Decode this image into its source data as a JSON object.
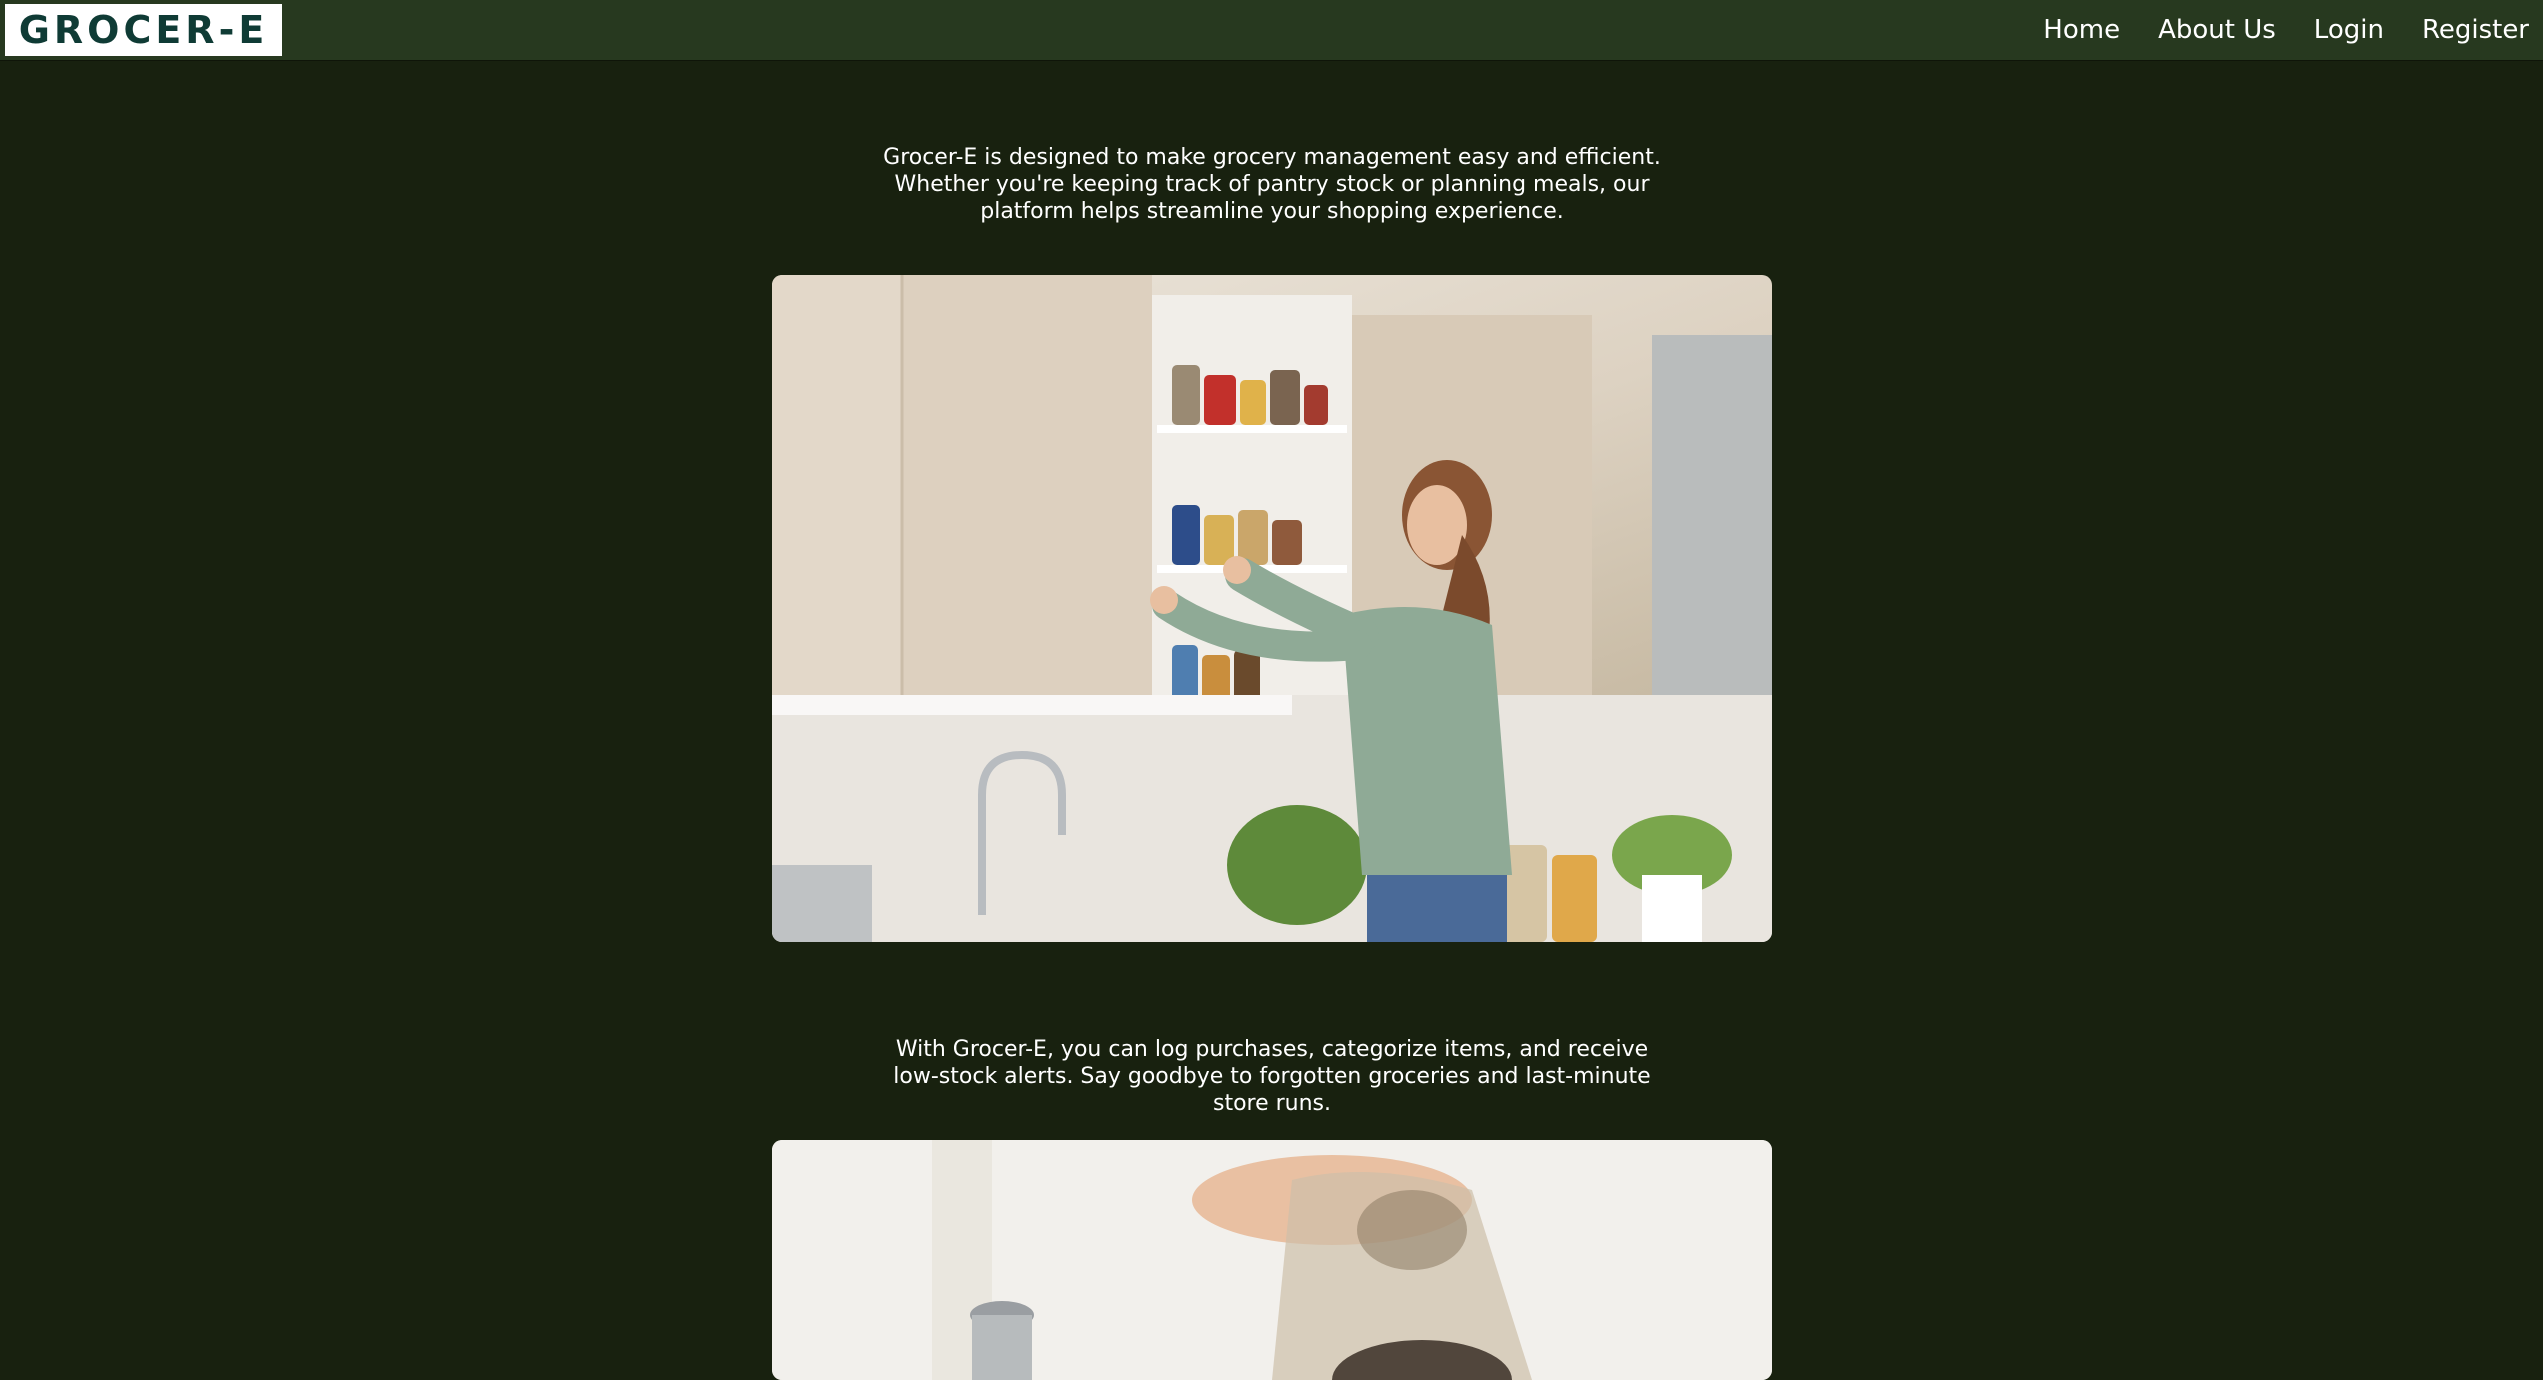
{
  "navbar": {
    "logo_text": "GROCER-E",
    "links": [
      "Home",
      "About Us",
      "Login",
      "Register"
    ]
  },
  "main": {
    "intro_text": "Grocer-E is designed to make grocery management easy and efficient. Whether you're keeping track of pantry stock or planning meals, our platform helps streamline your shopping experience.",
    "features_text": "With Grocer-E, you can log purchases, categorize items, and receive low-stock alerts. Say goodbye to forgotten groceries and last-minute store runs."
  },
  "colors": {
    "page_background": "#18210f",
    "navbar_background": "#27391f",
    "logo_text": "#0f3b35",
    "text": "#ffffff"
  }
}
